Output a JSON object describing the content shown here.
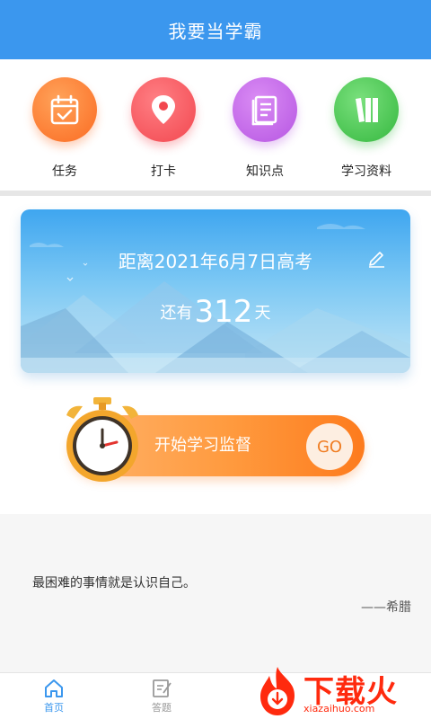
{
  "header": {
    "title": "我要当学霸"
  },
  "quick_nav": [
    {
      "label": "任务",
      "icon": "calendar-check-icon",
      "color": "#fb6b22"
    },
    {
      "label": "打卡",
      "icon": "location-pin-icon",
      "color": "#f2474f"
    },
    {
      "label": "知识点",
      "icon": "notebook-icon",
      "color": "#b656e2"
    },
    {
      "label": "学习资料",
      "icon": "books-icon",
      "color": "#35b83f"
    }
  ],
  "countdown": {
    "title": "距离2021年6月7日高考",
    "prefix": "还有",
    "days": "312",
    "suffix": "天"
  },
  "study": {
    "label": "开始学习监督",
    "go": "GO"
  },
  "quote": {
    "text": "最困难的事情就是认识自己。",
    "author": "——希腊"
  },
  "tabs": [
    {
      "label": "首页",
      "active": true
    },
    {
      "label": "答题",
      "active": false
    }
  ],
  "watermark": {
    "big": "下载火",
    "small": "xiazaihuo.com"
  },
  "colors": {
    "primary": "#3b97ee",
    "accent": "#fd7b1d"
  }
}
